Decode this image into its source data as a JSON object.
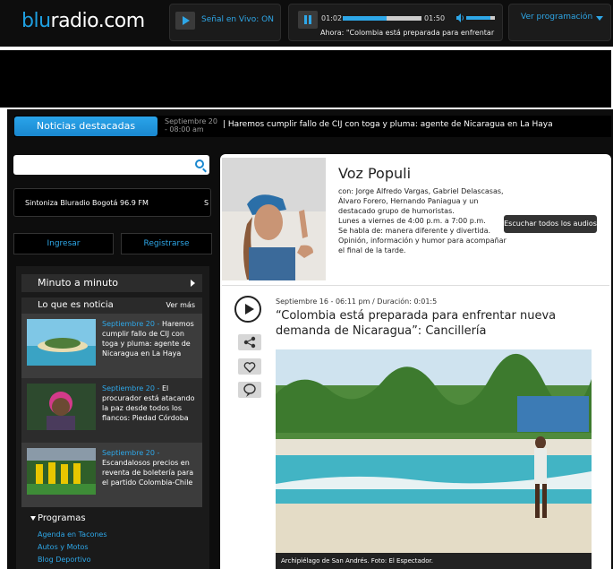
{
  "header": {
    "logo_pre": "blu",
    "logo_post": "radio.com",
    "live_label": "Señal en Vivo: ON",
    "time_elapsed": "01:02",
    "time_total": "01:50",
    "now_playing": "Ahora: \"Colombia está preparada para enfrentar",
    "progress": 0.56,
    "volume": 0.85,
    "programacion_label": "Ver programación"
  },
  "ticker": {
    "tab_label": "Noticias destacadas",
    "date": "Septiembre 20 - 08:00 am",
    "title": "| Haremos cumplir fallo de CIJ con toga y pluma: agente de Nicaragua en La Haya"
  },
  "sidebar": {
    "search_placeholder": "",
    "sintoniza": "Sintoniza Bluradio Bogotá 96.9 FM",
    "sintoniza_extra": "S",
    "ingresar": "Ingresar",
    "registrarse": "Registrarse",
    "minuto": "Minuto a minuto",
    "lo_que": "Lo que es noticia",
    "ver_mas": "Ver más",
    "news": [
      {
        "date": "Septiembre 20 -",
        "text": "Haremos cumplir fallo de CIJ con toga y pluma: agente de Nicaragua en La Haya"
      },
      {
        "date": "Septiembre 20 -",
        "text": "El procurador está atacando la paz desde todos los flancos: Piedad Córdoba"
      },
      {
        "date": "Septiembre 20 -",
        "text": "Escandalosos precios en reventa de boletería para el partido Colombia-Chile"
      }
    ],
    "programas": "Programas",
    "programas_links": [
      "Agenda en Tacones",
      "Autos y Motos",
      "Blog Deportivo"
    ]
  },
  "main": {
    "title": "Voz Populi",
    "con_label": "con:",
    "con_text": "Jorge Alfredo Vargas, Gabriel Delascasas, Álvaro Forero, Hernando Paniagua y un destacado grupo de humoristas.",
    "schedule": "Lunes a viernes de 4:00 p.m. a 7:00 p.m.",
    "habla": "Se habla de:  manera diferente y divertida.",
    "desc": "Opinión, información y humor para acompañar el final de la tarde.",
    "listen_btn": "Escuchar todos los audios",
    "meta": "Septiembre 16 - 06:11 pm / Duración: 0:01:5",
    "headline": "“Colombia está preparada para enfrentar nueva demanda de Nicaragua”: Cancillería",
    "caption": "Archipiélago de San Andrés. Foto: El Espectador."
  }
}
